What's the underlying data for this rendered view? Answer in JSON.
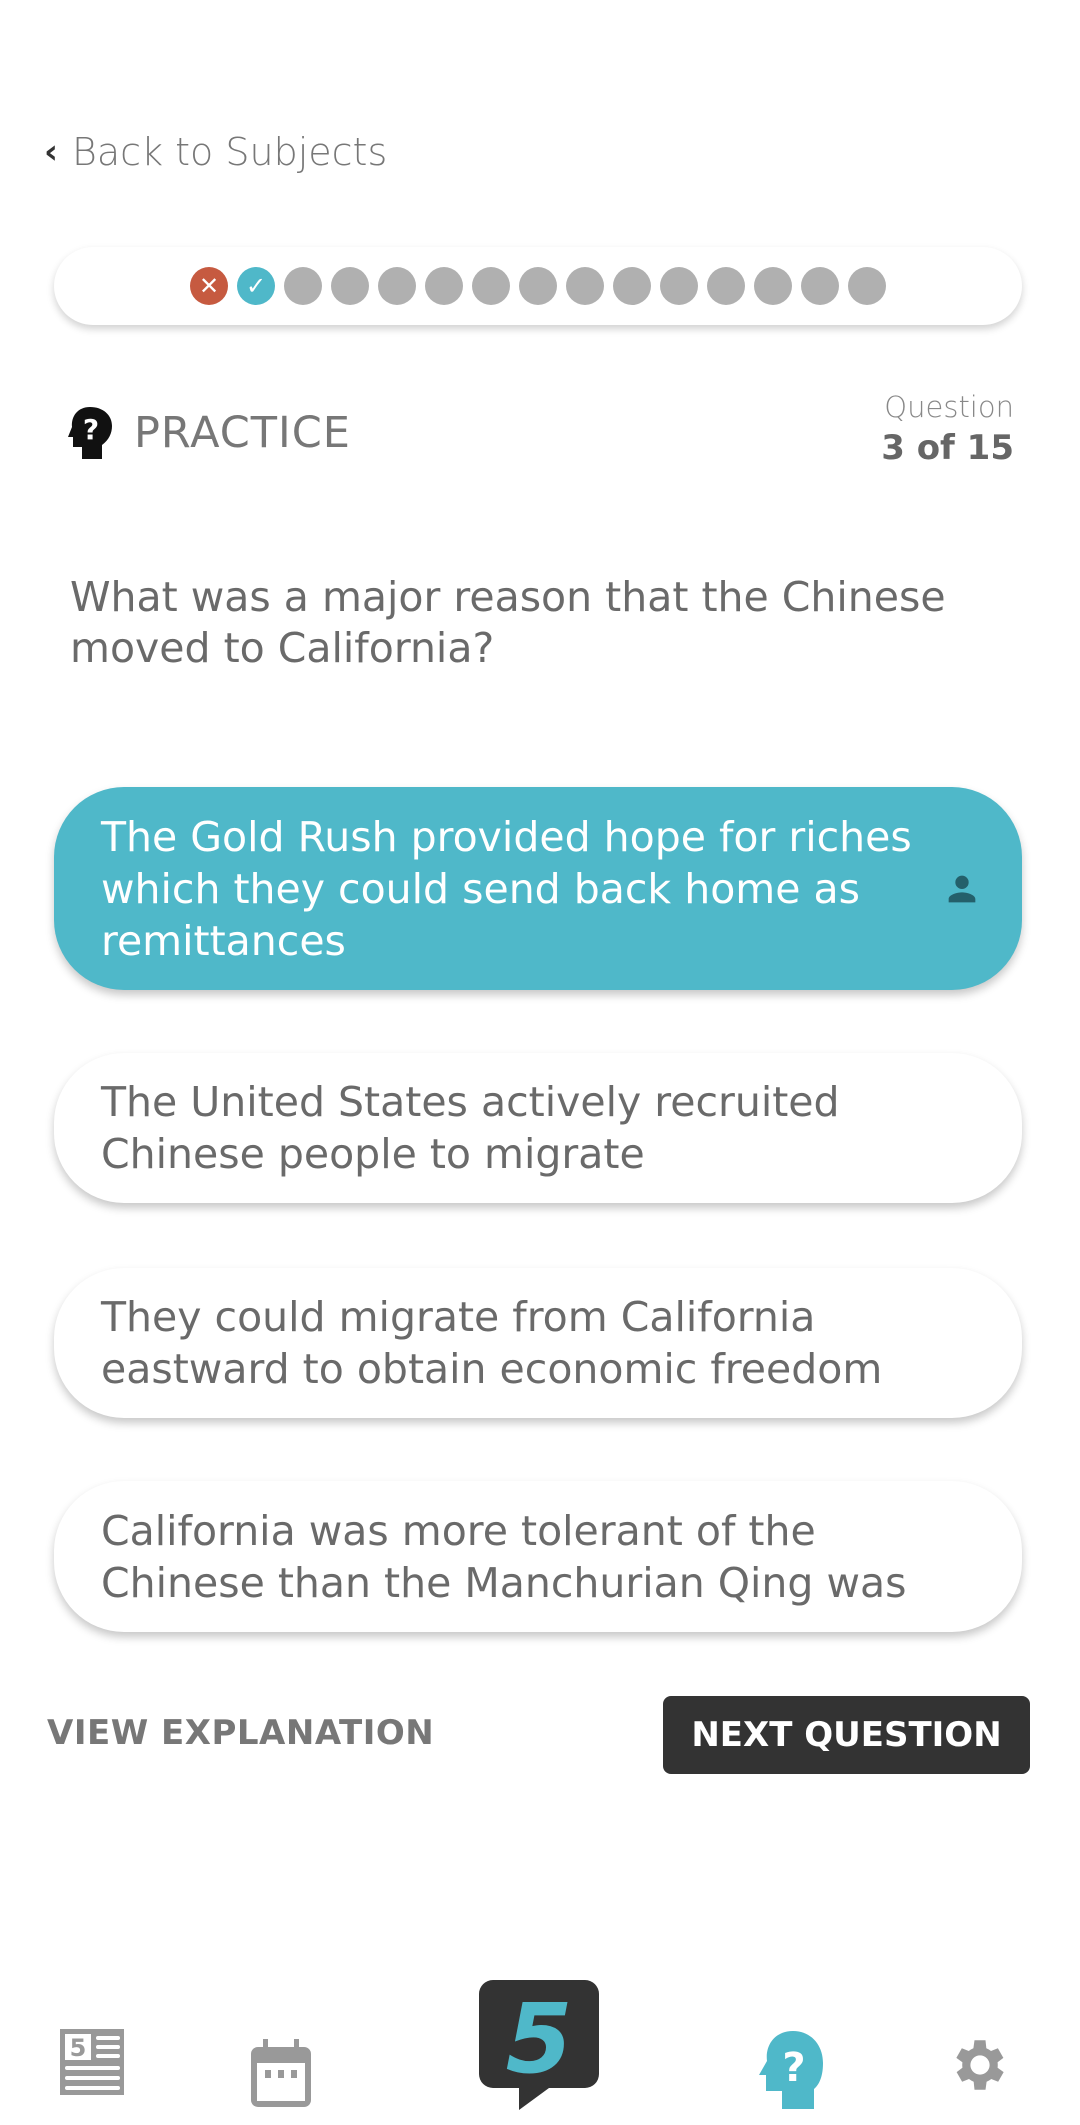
{
  "nav_back": {
    "label": "Back to Subjects"
  },
  "progress": {
    "total": 15,
    "current": 3,
    "results": [
      "incorrect",
      "correct",
      "none",
      "none",
      "none",
      "none",
      "none",
      "none",
      "none",
      "none",
      "none",
      "none",
      "none",
      "none",
      "none"
    ]
  },
  "header": {
    "mode": "PRACTICE",
    "question_label": "Question",
    "question_count": "3 of 15"
  },
  "question": {
    "text": "What was a major reason that the Chinese moved to California?"
  },
  "options": [
    {
      "text": "The Gold Rush provided hope for riches which they could send back home as remittances",
      "selected": true
    },
    {
      "text": "The United States actively recruited Chinese people to migrate",
      "selected": false
    },
    {
      "text": "They could migrate from California eastward to obtain economic freedom",
      "selected": false
    },
    {
      "text": "California was more tolerant of the Chinese than the Manchurian Qing was",
      "selected": false
    }
  ],
  "actions": {
    "view_explanation": "VIEW EXPLANATION",
    "next_question": "NEXT QUESTION"
  },
  "bottom_nav": {
    "logo_text": "5",
    "items": [
      "news",
      "calendar",
      "home",
      "practice",
      "settings"
    ],
    "active": "practice"
  },
  "colors": {
    "accent": "#4fb8c9",
    "incorrect": "#c65a40",
    "dark": "#333333",
    "inactive": "#999999"
  }
}
